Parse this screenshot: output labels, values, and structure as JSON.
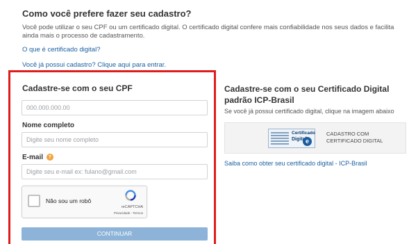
{
  "page": {
    "heading": "Como você prefere fazer seu cadastro?",
    "intro": "Você pode utilizar o seu CPF ou um certificado digital. O certificado digital confere mais confiabilidade nos seus dados e facilita ainda mais o processo de cadastramento.",
    "what_is_cert_link": "O que é certificado digital?",
    "already_registered_link": "Você já possui cadastro? Clique aqui para entrar."
  },
  "cpf_form": {
    "title": "Cadastre-se com o seu CPF",
    "cpf_placeholder": "000.000.000.00",
    "name_label": "Nome completo",
    "name_placeholder": "Digite seu nome completo",
    "email_label": "E-mail",
    "email_help_icon": "?",
    "email_placeholder": "Digite seu e-mail ex: fulano@gmail.com",
    "captcha": {
      "label": "Não sou um robô",
      "brand": "reCAPTCHA",
      "terms": "Privacidade - Termos"
    },
    "continue_label": "CONTINUAR",
    "highlight_color": "#e01b1b"
  },
  "cert_panel": {
    "title": "Cadastre-se com o seu Certificado Digital padrão ICP-Brasil",
    "description": "Se você já possui certificado digital, clique na imagem abaixo",
    "logo_line1": "Certificado",
    "logo_line2": "Digital",
    "logo_mark": "e",
    "button_text": "CADASTRO COM CERTIFICADO DIGITAL",
    "howto_link": "Saiba como obter seu certificado digital - ICP-Brasil"
  }
}
